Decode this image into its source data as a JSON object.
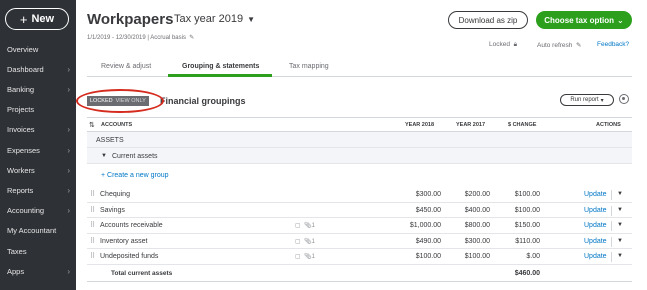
{
  "sidebar": {
    "new_label": "New",
    "items": [
      {
        "label": "Overview",
        "chevron": false
      },
      {
        "label": "Dashboard",
        "chevron": true
      },
      {
        "label": "Banking",
        "chevron": true
      },
      {
        "label": "Projects",
        "chevron": false
      },
      {
        "label": "Invoices",
        "chevron": true
      },
      {
        "label": "Expenses",
        "chevron": true
      },
      {
        "label": "Workers",
        "chevron": true
      },
      {
        "label": "Reports",
        "chevron": true
      },
      {
        "label": "Accounting",
        "chevron": true
      },
      {
        "label": "My Accountant",
        "chevron": false
      },
      {
        "label": "Taxes",
        "chevron": false
      },
      {
        "label": "Apps",
        "chevron": true
      }
    ]
  },
  "header": {
    "title": "Workpapers",
    "tax_year": "Tax year 2019",
    "period": "1/1/2019 - 12/30/2019  |  Accrual basis",
    "download_label": "Download as zip",
    "tax_option_label": "Choose tax option",
    "locked_label": "Locked",
    "auto_refresh_label": "Auto refresh",
    "feedback_label": "Feedback?"
  },
  "tabs": [
    {
      "label": "Review & adjust",
      "active": false
    },
    {
      "label": "Grouping & statements",
      "active": true
    },
    {
      "label": "Tax mapping",
      "active": false
    }
  ],
  "section": {
    "locked_badge": "LOCKED",
    "view_only": "VIEW ONLY",
    "title": "Financial groupings",
    "run_report_label": "Run report"
  },
  "table": {
    "columns": {
      "accounts": "ACCOUNTS",
      "year_2018": "YEAR 2018",
      "year_2017": "YEAR 2017",
      "change": "$ CHANGE",
      "actions": "ACTIONS"
    },
    "group_header": "ASSETS",
    "subgroup": "Current assets",
    "create_group": "+ Create a new group",
    "rows": [
      {
        "name": "Chequing",
        "y2018": "$300.00",
        "y2017": "$200.00",
        "change": "$100.00",
        "action": "Update",
        "attachments": ""
      },
      {
        "name": "Savings",
        "y2018": "$450.00",
        "y2017": "$400.00",
        "change": "$100.00",
        "action": "Update",
        "attachments": ""
      },
      {
        "name": "Accounts receivable",
        "y2018": "$1,000.00",
        "y2017": "$800.00",
        "change": "$150.00",
        "action": "Update",
        "attachments": "1"
      },
      {
        "name": "Inventory asset",
        "y2018": "$490.00",
        "y2017": "$300.00",
        "change": "$110.00",
        "action": "Update",
        "attachments": "1"
      },
      {
        "name": "Undeposited funds",
        "y2018": "$100.00",
        "y2017": "$100.00",
        "change": "$.00",
        "action": "Update",
        "attachments": "1"
      }
    ],
    "total_label": "Total current assets",
    "total_change": "$460.00"
  }
}
